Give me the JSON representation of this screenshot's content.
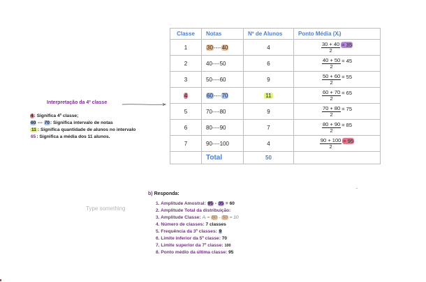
{
  "tiny_label": "—",
  "table": {
    "headers": [
      "Classe",
      "Notas",
      "Nº de Alunos",
      "Ponto Média (Xᵢ)"
    ],
    "rows": [
      {
        "classe": "1",
        "notas_a": "30",
        "notas_sep": "----",
        "notas_b": "40",
        "alunos": "4",
        "pm_num": "30 + 40",
        "pm_den": "2",
        "pm_res": "= 35"
      },
      {
        "classe": "2",
        "notas_a": "40",
        "notas_sep": "----",
        "notas_b": "50",
        "alunos": "6",
        "pm_num": "40 + 50",
        "pm_den": "2",
        "pm_res": "= 45"
      },
      {
        "classe": "3",
        "notas_a": "50",
        "notas_sep": "----",
        "notas_b": "60",
        "alunos": "9",
        "pm_num": "50 + 60",
        "pm_den": "2",
        "pm_res": "= 55"
      },
      {
        "classe": "4",
        "notas_a": "60",
        "notas_sep": "----",
        "notas_b": "70",
        "alunos": "11",
        "pm_num": "60 + 70",
        "pm_den": "2",
        "pm_res": "= 65"
      },
      {
        "classe": "5",
        "notas_a": "70",
        "notas_sep": "----",
        "notas_b": "80",
        "alunos": "9",
        "pm_num": "70 + 80",
        "pm_den": "2",
        "pm_res": "= 75"
      },
      {
        "classe": "6",
        "notas_a": "80",
        "notas_sep": "----",
        "notas_b": "90",
        "alunos": "7",
        "pm_num": "80 + 90",
        "pm_den": "2",
        "pm_res": "= 85"
      },
      {
        "classe": "7",
        "notas_a": "90",
        "notas_sep": "----",
        "notas_b": "100",
        "alunos": "4",
        "pm_num": "90 + 100",
        "pm_den": "2",
        "pm_res": "= 95"
      }
    ],
    "total_label": "Total",
    "total_value": "50"
  },
  "interpretation": {
    "title": "Interpretação da 4º classe",
    "lines": [
      {
        "key": "4",
        "text": ": Significa 4º classe;"
      },
      {
        "key_a": "60",
        "sep": " --- ",
        "key_b": "70",
        "text": ": Significa intervalo de notas"
      },
      {
        "key": "11",
        "text": ": Significa quantidade de alunos no intervalo"
      },
      {
        "key": "65",
        "text": ": Significa a média dos 11 alunos."
      }
    ]
  },
  "placeholder": "Type something",
  "answers": {
    "title_b": "b) ",
    "title_rest": "Responda:",
    "items": [
      {
        "q": "1. Amplitude Amostral: ",
        "a": "95 - 35 = 60"
      },
      {
        "q": "2. Amplitude Total da distribuição:",
        "a": ""
      },
      {
        "q": "3. Amplitude Classe: ",
        "a": "Aᵢ = 60 - 50 = 10"
      },
      {
        "q": "4. Número de classes: ",
        "a": "7 classes"
      },
      {
        "q": "5. Frequência da 3º classes: ",
        "a": "9"
      },
      {
        "q": "6. Limite inferior da 5º classe: ",
        "a": "70"
      },
      {
        "q": "7. Limite superior da 7º classe: ",
        "a": "100"
      },
      {
        "q": "8. Ponto médio da última classe: ",
        "a": "95"
      }
    ]
  }
}
